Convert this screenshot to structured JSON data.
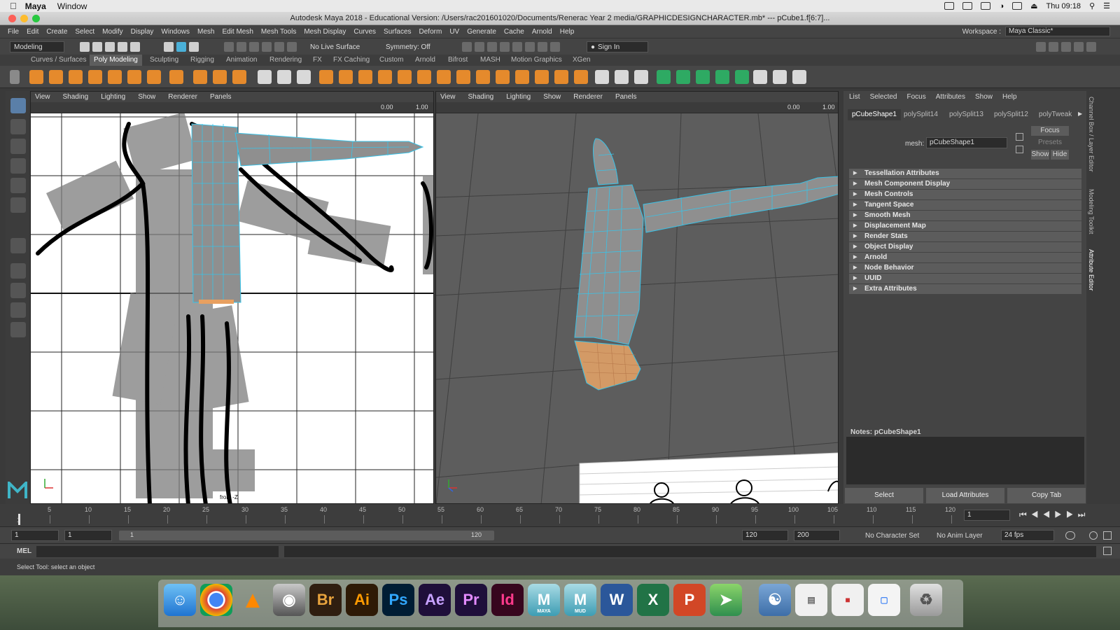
{
  "macbar": {
    "app_name": "Maya",
    "menu": [
      "Window"
    ],
    "clock": "Thu 09:18"
  },
  "titlebar": {
    "title": "Autodesk Maya 2018 - Educational Version: /Users/rac201601020/Documents/Renerac Year 2 media/GRAPHICDESIGNCHARACTER.mb*  ---  pCube1.f[6:7]..."
  },
  "menubar": {
    "items": [
      "File",
      "Edit",
      "Create",
      "Select",
      "Modify",
      "Display",
      "Windows",
      "Mesh",
      "Edit Mesh",
      "Mesh Tools",
      "Mesh Display",
      "Curves",
      "Surfaces",
      "Deform",
      "UV",
      "Generate",
      "Cache",
      "Arnold",
      "Help"
    ],
    "workspace_label": "Workspace :",
    "workspace_value": "Maya Classic*"
  },
  "statusline": {
    "mode": "Modeling",
    "live_surface": "No Live Surface",
    "symmetry": "Symmetry: Off",
    "sign_in": "Sign In"
  },
  "shelf_tabs": [
    "Curves / Surfaces",
    "Poly Modeling",
    "Sculpting",
    "Rigging",
    "Animation",
    "Rendering",
    "FX",
    "FX Caching",
    "Custom",
    "Arnold",
    "Bifrost",
    "MASH",
    "Motion Graphics",
    "XGen"
  ],
  "viewport_menu": [
    "View",
    "Shading",
    "Lighting",
    "Show",
    "Renderer",
    "Panels"
  ],
  "viewport_left": {
    "field1": "0.00",
    "field2": "1.00",
    "camera_label": "front -Z"
  },
  "viewport_right": {
    "field1": "0.00",
    "field2": "1.00"
  },
  "attribute_editor": {
    "menu": [
      "List",
      "Selected",
      "Focus",
      "Attributes",
      "Show",
      "Help"
    ],
    "tabs": [
      "pCubeShape1",
      "polySplit14",
      "polySplit13",
      "polySplit12",
      "polyTweak"
    ],
    "mesh_label": "mesh:",
    "mesh_value": "pCubeShape1",
    "focus_btn": "Focus",
    "presets_btn": "Presets",
    "show_btn": "Show",
    "hide_btn": "Hide",
    "sections": [
      "Tessellation Attributes",
      "Mesh Component Display",
      "Mesh Controls",
      "Tangent Space",
      "Smooth Mesh",
      "Displacement Map",
      "Render Stats",
      "Object Display",
      "Arnold",
      "Node Behavior",
      "UUID",
      "Extra Attributes"
    ],
    "notes_label": "Notes:  pCubeShape1",
    "buttons": [
      "Select",
      "Load Attributes",
      "Copy Tab"
    ]
  },
  "side_tabs": [
    "Channel Box / Layer Editor",
    "Modeling Toolkit",
    "Attribute Editor"
  ],
  "timeslider": {
    "ticks": [
      "5",
      "10",
      "15",
      "20",
      "25",
      "30",
      "35",
      "40",
      "45",
      "50",
      "55",
      "60",
      "65",
      "70",
      "75",
      "80",
      "85",
      "90",
      "95",
      "100",
      "105",
      "110",
      "115",
      "120"
    ],
    "start_mark": "1",
    "current_frame": "1"
  },
  "range": {
    "start": "1",
    "playback_start": "1",
    "slider_start": "1",
    "slider_end": "120",
    "playback_end": "120",
    "end": "200",
    "character_set": "No Character Set",
    "anim_layer": "No Anim Layer",
    "fps": "24 fps"
  },
  "cmdline": {
    "lang": "MEL"
  },
  "helpline": {
    "text": "Select Tool: select an object"
  },
  "dock": [
    {
      "name": "Br",
      "color": "#2f1e10",
      "fg": "#e8a33d"
    },
    {
      "name": "Ai",
      "color": "#2e1a06",
      "fg": "#ff9a00"
    },
    {
      "name": "Ps",
      "color": "#001d34",
      "fg": "#31a8ff"
    },
    {
      "name": "Ae",
      "color": "#1f0f3a",
      "fg": "#c7a2ff"
    },
    {
      "name": "Pr",
      "color": "#1f0f3a",
      "fg": "#e38bff"
    },
    {
      "name": "Id",
      "color": "#37061e",
      "fg": "#ff3a8c"
    }
  ],
  "dock_maya_labels": [
    "MAYA",
    "MUD"
  ]
}
